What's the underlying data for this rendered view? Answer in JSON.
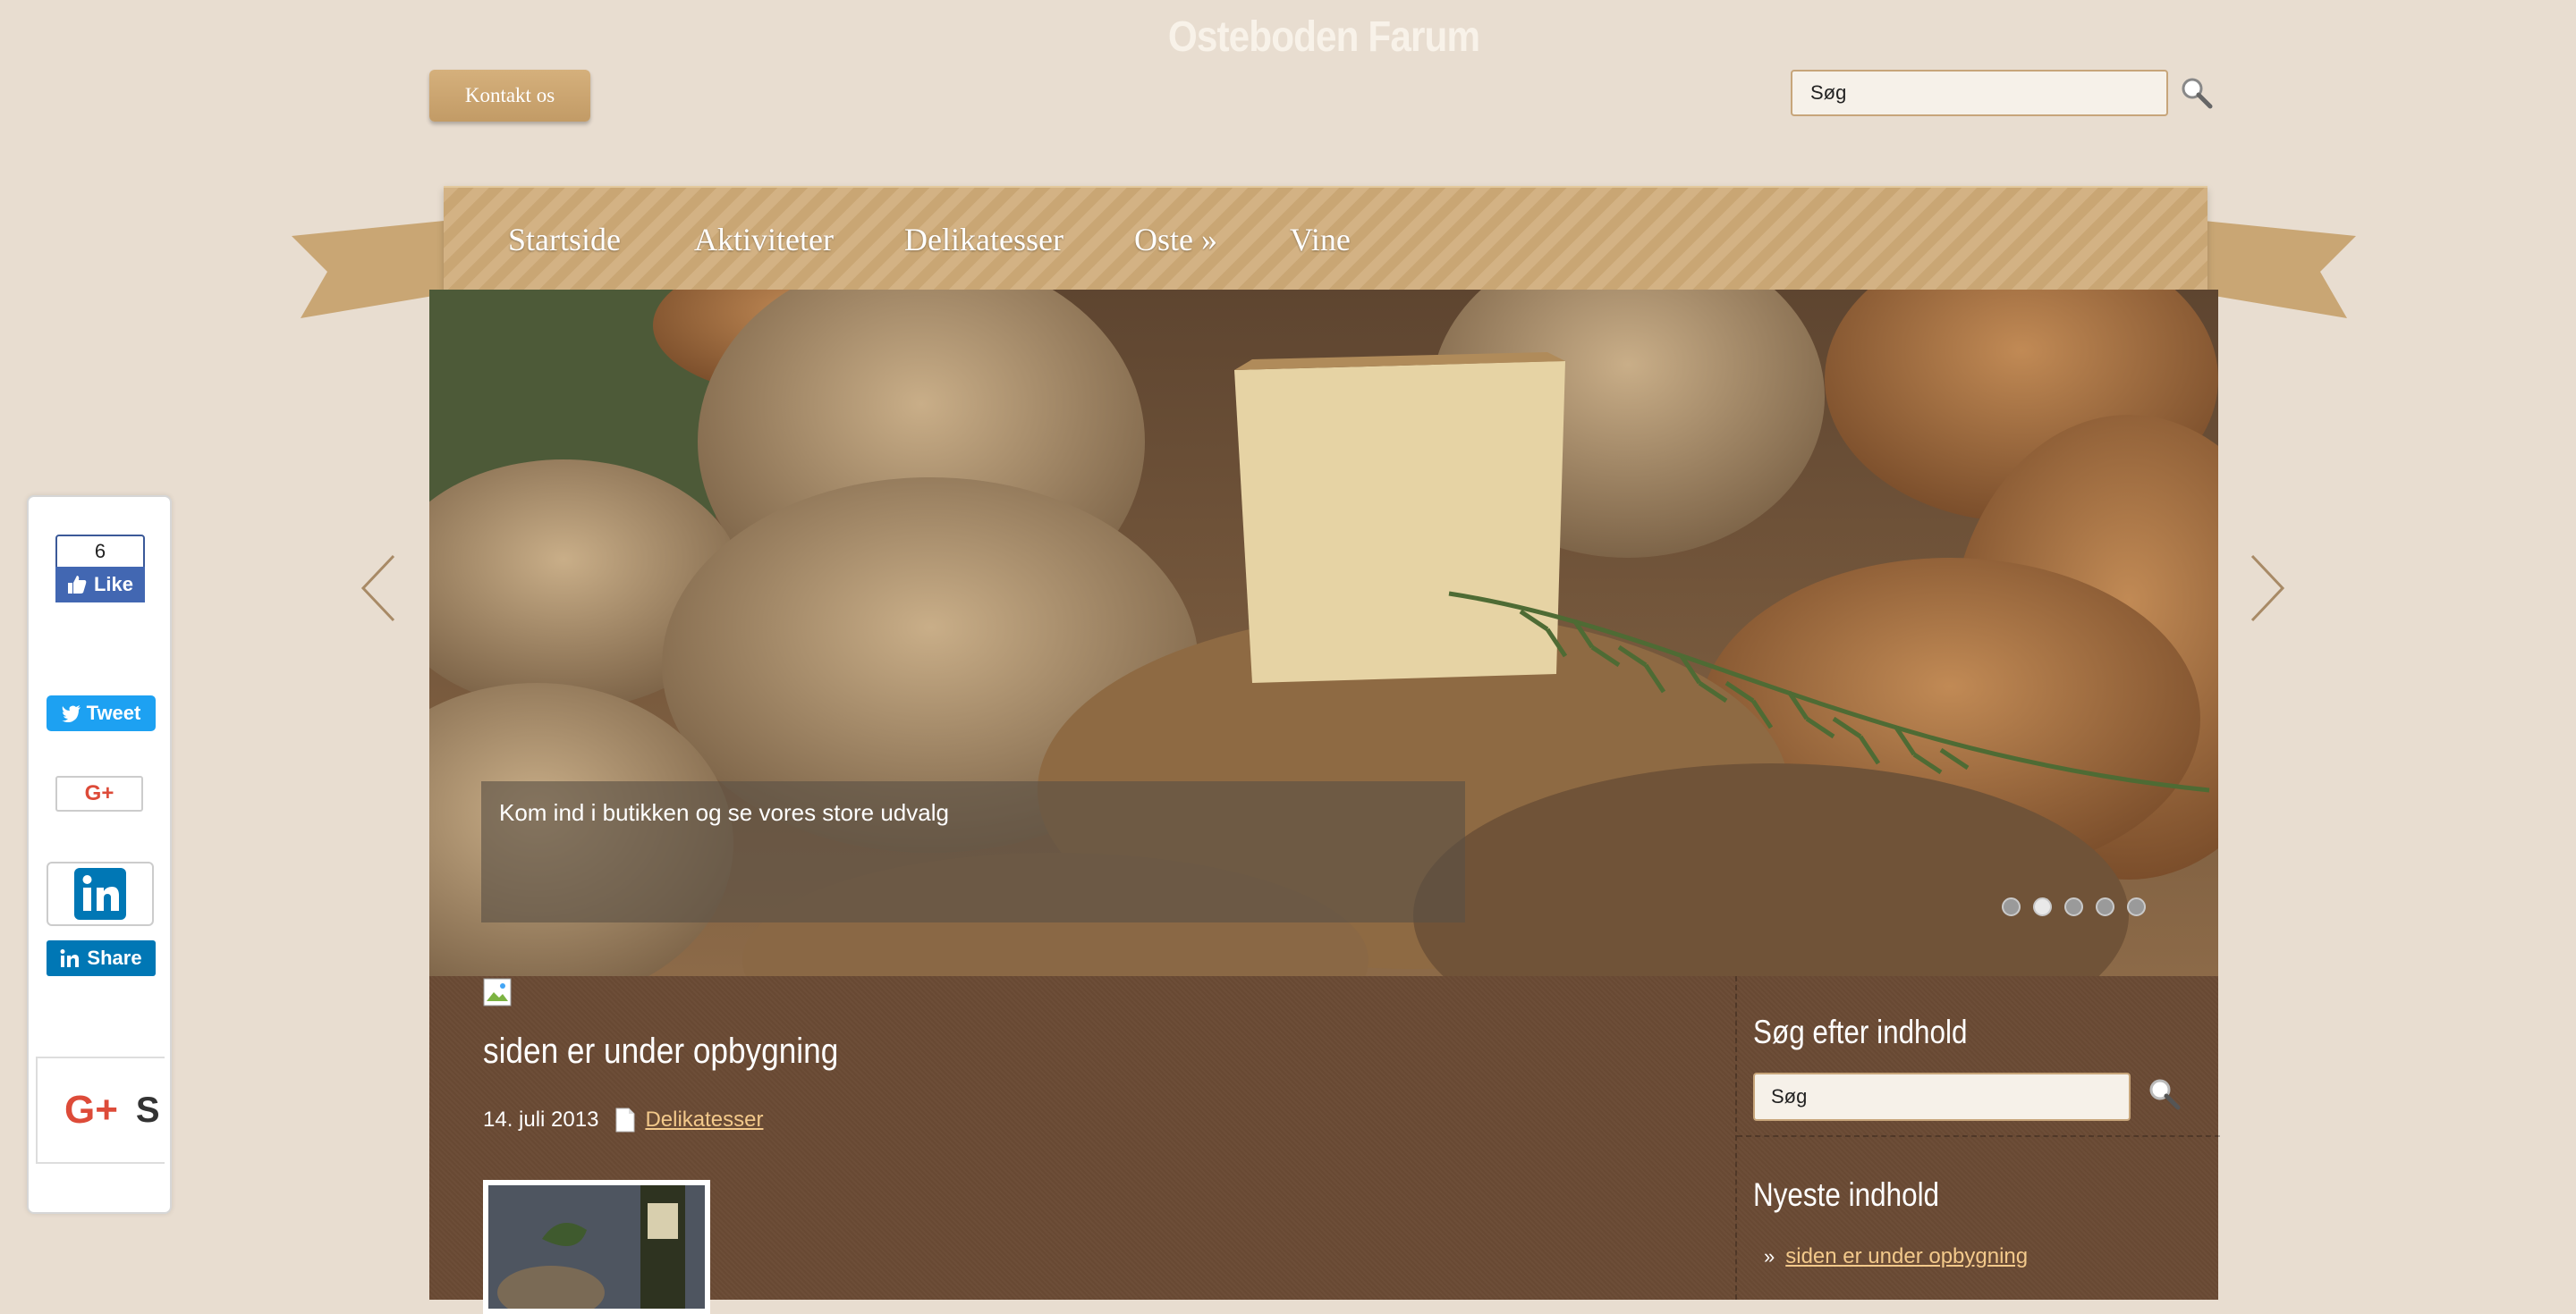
{
  "header": {
    "site_title": "Osteboden Farum",
    "contact_label": "Kontakt os",
    "search_value": "Søg"
  },
  "nav": {
    "items": [
      {
        "label": "Startside"
      },
      {
        "label": "Aktiviteter"
      },
      {
        "label": "Delikatesser"
      },
      {
        "label": "Oste »"
      },
      {
        "label": "Vine"
      }
    ]
  },
  "slider": {
    "caption": "Kom ind i butikken og se vores store udvalg",
    "dot_count": 5,
    "active_dot": 2
  },
  "post": {
    "title": "siden er under opbygning",
    "date": "14. juli 2013",
    "category": "Delikatesser"
  },
  "sidebar": {
    "search_heading": "Søg efter indhold",
    "search_value": "Søg",
    "newest_heading": "Nyeste indhold",
    "newest_items": [
      {
        "label": "siden er under opbygning"
      }
    ]
  },
  "social": {
    "fb_count": "6",
    "fb_like_label": "Like",
    "tweet_label": "Tweet",
    "gplus_label": "G+",
    "linkedin_share_label": "Share",
    "gplus_big_label": "G+",
    "gplus_big_text": "S"
  },
  "colors": {
    "background": "#e8ddd0",
    "accent": "#c9a674",
    "content_bg": "#6a4a34",
    "link": "#f3c98b"
  }
}
